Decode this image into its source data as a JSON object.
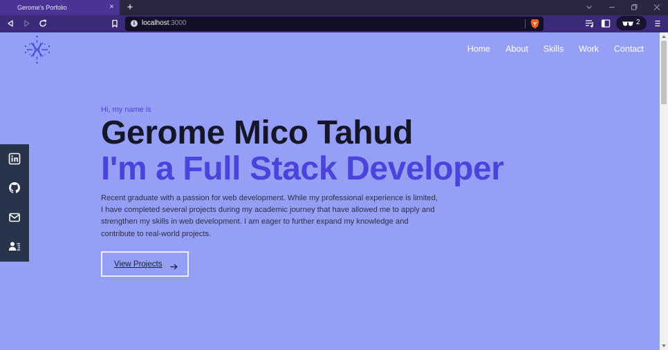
{
  "browser": {
    "tab_title": "Gerome's Porfolio",
    "tab_close": "×",
    "new_tab": "+",
    "address_host": "localhost",
    "address_port": ":3000",
    "shields_count": "2"
  },
  "header": {
    "nav": [
      "Home",
      "About",
      "Skills",
      "Work",
      "Contact"
    ]
  },
  "socials": [
    "linkedin-icon",
    "github-icon",
    "mail-icon",
    "resume-icon"
  ],
  "hero": {
    "greeting": "Hi, my name is",
    "name": "Gerome Mico Tahud",
    "role": "I'm a Full Stack Developer",
    "bio": "Recent graduate with a passion for web development. While my professional experience is limited, I have completed several projects during my academic journey that have allowed me to apply and strengthen my skills in web development. I am eager to further expand my knowledge and contribute to real-world projects.",
    "cta_label": "View Projects"
  },
  "colors": {
    "page_bg": "#959ff5",
    "accent": "#4a43dc",
    "sidebar": "#27344a",
    "tab_active": "#4b3396"
  }
}
